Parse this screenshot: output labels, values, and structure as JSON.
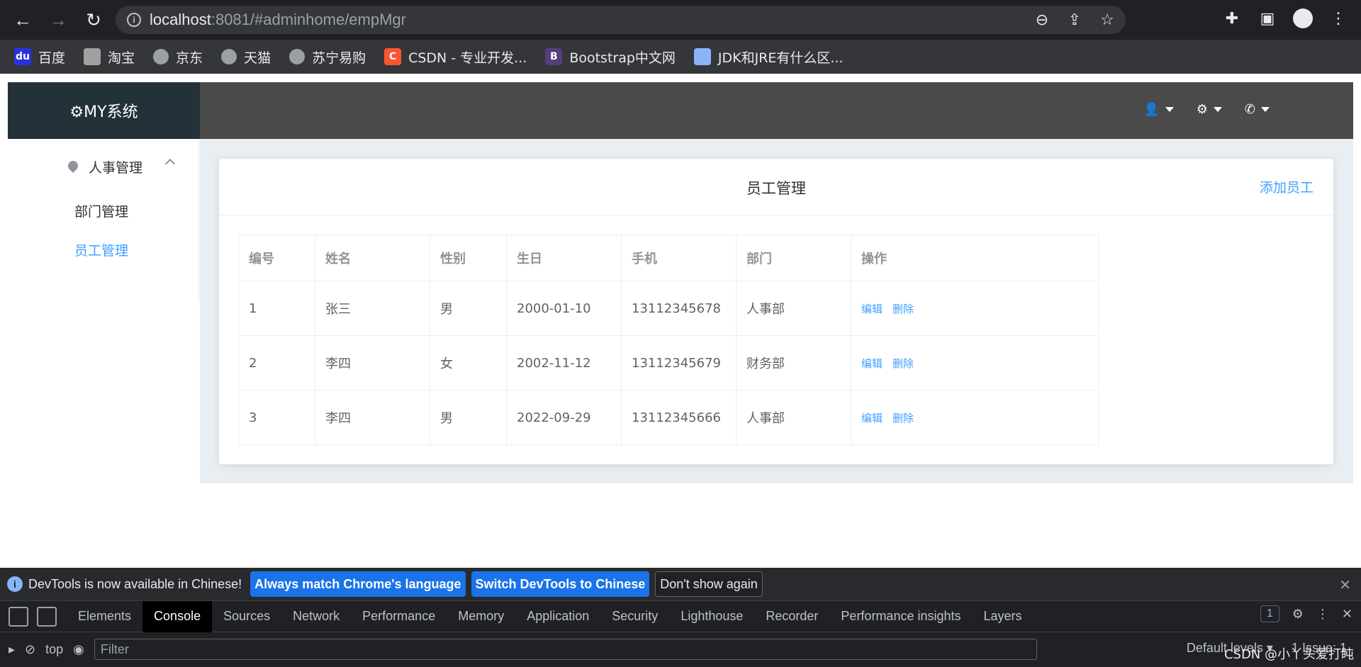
{
  "browser": {
    "url_host": "localhost",
    "url_rest": ":8081/#adminhome/empMgr",
    "bookmarks": [
      "百度",
      "淘宝",
      "京东",
      "天猫",
      "苏宁易购",
      "CSDN - 专业开发...",
      "Bootstrap中文网",
      "JDK和JRE有什么区..."
    ]
  },
  "app": {
    "brand": "⚙MY系统",
    "sidebar": {
      "group_label": "人事管理",
      "items": [
        "部门管理",
        "员工管理"
      ]
    },
    "card": {
      "title": "员工管理",
      "add_button": "添加员工"
    },
    "table": {
      "headers": [
        "编号",
        "姓名",
        "性别",
        "生日",
        "手机",
        "部门",
        "操作"
      ],
      "rows": [
        [
          "1",
          "张三",
          "男",
          "2000-01-10",
          "13112345678",
          "人事部"
        ],
        [
          "2",
          "李四",
          "女",
          "2002-11-12",
          "13112345679",
          "财务部"
        ],
        [
          "3",
          "李四",
          "男",
          "2022-09-29",
          "13112345666",
          "人事部"
        ]
      ],
      "edit_label": "编辑",
      "delete_label": "删除"
    }
  },
  "devtools": {
    "banner_message": "DevTools is now available in Chinese!",
    "btn_match": "Always match Chrome's language",
    "btn_switch": "Switch DevTools to Chinese",
    "btn_dont_show": "Don't show again",
    "tabs": [
      "Elements",
      "Console",
      "Sources",
      "Network",
      "Performance",
      "Memory",
      "Application",
      "Security",
      "Lighthouse",
      "Recorder",
      "Performance insights",
      "Layers"
    ],
    "active_tab": "Console",
    "badge_count": "1",
    "context": "top",
    "filter_placeholder": "Filter",
    "levels": "Default levels ▾",
    "issues": "1 Issue: 1"
  },
  "watermark": "CSDN @小丫头爱打盹"
}
